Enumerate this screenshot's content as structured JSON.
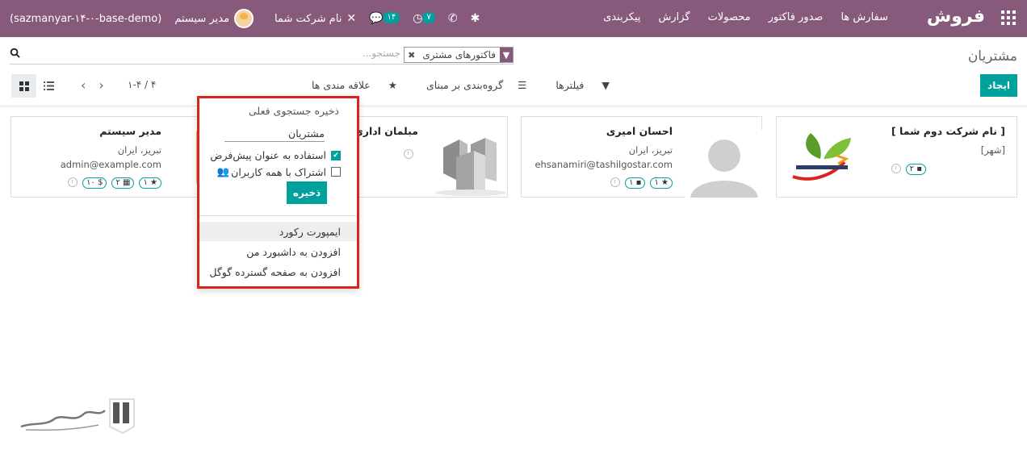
{
  "topbar": {
    "app_title": "فروش",
    "menu": [
      "سفارش ها",
      "صدور فاکتور",
      "محصولات",
      "گزارش",
      "پیکربندی"
    ],
    "company": "نام شرکت شما",
    "chat_count": "۱۴",
    "activity_count": "۷",
    "user_name": "مدیر سیستم",
    "db_name": "(sazmanyar-۱۴-۰-base-demo)",
    "brand_color": "#875a7b"
  },
  "page": {
    "title": "مشتریان"
  },
  "search": {
    "facet_label": "فاکتورهای مشتری",
    "placeholder": "جستجو..."
  },
  "toolbar": {
    "create_label": "ایجاد",
    "filters_label": "فیلترها",
    "groupby_label": "گروه‌بندی بر مبنای",
    "favorites_label": "علاقه مندی ها",
    "pager": "۱-۴ / ۴"
  },
  "cards": [
    {
      "name": "[ نام شرکت دوم شما ]",
      "line1": "[شهر]",
      "line2": "",
      "tags": [
        "۲"
      ]
    },
    {
      "name": "احسان امیری",
      "line1": "تبریز، ایران",
      "line2": "ehsanamiri@tashilgostar.com",
      "tags": [
        "۱",
        "۱"
      ]
    },
    {
      "name": "مبلمان اداری",
      "line1": "",
      "line2": "",
      "tags": []
    },
    {
      "name": "مدیر سیستم",
      "line1": "تبریز، ایران",
      "line2": "admin@example.com",
      "tags": [
        "۱",
        "۲",
        "۱۰"
      ]
    }
  ],
  "dropdown": {
    "header": "ذخیره جستجوی فعلی",
    "name_value": "مشتریان",
    "use_default_label": "استفاده به عنوان پیش‌فرض",
    "share_label": "اشتراک با همه کاربران",
    "save_label": "ذخیره",
    "import_label": "ایمپورت رکورد",
    "dashboard_label": "افزودن به داشبورد من",
    "gsheet_label": "افزودن به صفحه گسترده گوگل"
  },
  "accent_color": "#00a09d",
  "highlight_color": "#d9251d"
}
